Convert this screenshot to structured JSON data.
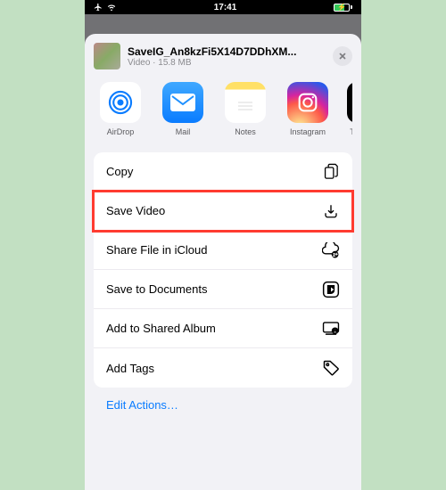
{
  "status": {
    "time": "17:41"
  },
  "file": {
    "name": "SaveIG_An8kzFi5X14D7DDhXM...",
    "type": "Video",
    "size": "15.8 MB",
    "meta": "Video · 15.8 MB"
  },
  "share_apps": {
    "airdrop": "AirDrop",
    "mail": "Mail",
    "notes": "Notes",
    "instagram": "Instagram",
    "more": "T"
  },
  "actions": {
    "copy": "Copy",
    "save_video": "Save Video",
    "share_icloud": "Share File in iCloud",
    "save_docs": "Save to Documents",
    "shared_album": "Add to Shared Album",
    "add_tags": "Add Tags"
  },
  "edit": "Edit Actions…",
  "colors": {
    "highlight": "#ff3b30",
    "link": "#0a7cff",
    "sheet_bg": "#f2f2f6"
  },
  "highlighted_action": "save_video"
}
